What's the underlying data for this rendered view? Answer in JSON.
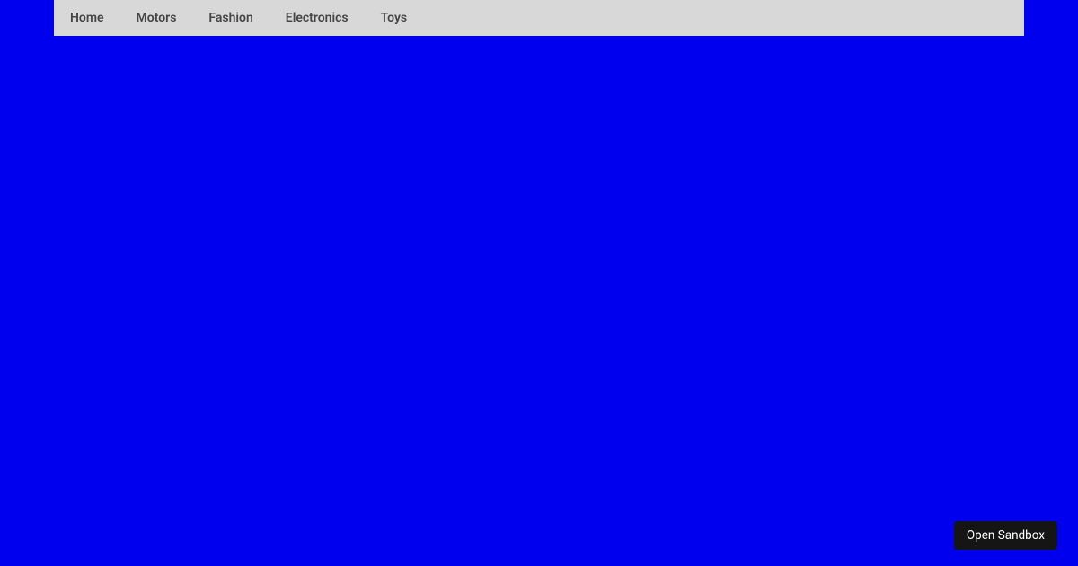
{
  "nav": {
    "items": [
      {
        "label": "Home"
      },
      {
        "label": "Motors"
      },
      {
        "label": "Fashion"
      },
      {
        "label": "Electronics"
      },
      {
        "label": "Toys"
      }
    ]
  },
  "footer": {
    "open_sandbox_label": "Open Sandbox"
  }
}
